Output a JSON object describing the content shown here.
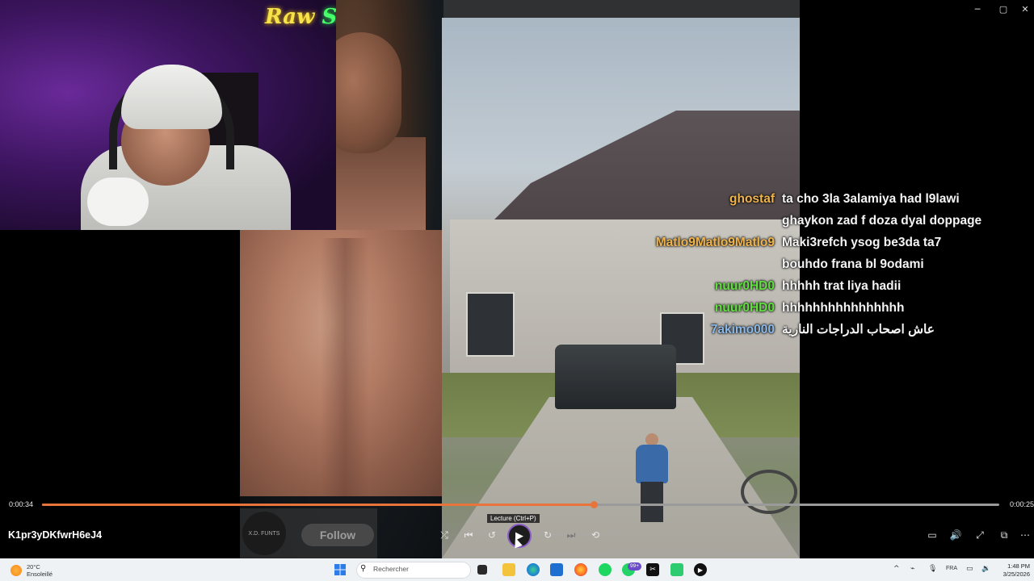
{
  "window": {
    "minimize_glyph": "─",
    "maximize_glyph": "▢",
    "close_glyph": "✕"
  },
  "webcam": {
    "neon_sign_part1": "Raw ",
    "neon_sign_part2": "Sauce"
  },
  "chat": {
    "messages": [
      {
        "user": "ghostaf",
        "user_color": "#f0b44c",
        "text": "ta cho 3la 3alamiya had l9lawi"
      },
      {
        "user": "",
        "user_color": "#f0b44c",
        "text": "ghaykon zad f doza dyal doppage"
      },
      {
        "user": "Matlo9Matlo9Matlo9",
        "user_color": "#f0b44c",
        "text": "Maki3refch ysog be3da ta7"
      },
      {
        "user": "",
        "user_color": "#f0b44c",
        "text": "bouhdo frana bl 9odami"
      },
      {
        "user": "nuur0HD0",
        "user_color": "#5fe03f",
        "text": "hhhhh trat liya hadii"
      },
      {
        "user": "nuur0HD0",
        "user_color": "#5fe03f",
        "text": "hhhhhhhhhhhhhhhh"
      },
      {
        "user": "7akimo000",
        "user_color": "#8ab8e8",
        "text": "عاش اصحاب الدراجات النارية"
      }
    ]
  },
  "follow": {
    "label": "Follow",
    "avatar_text": "X.D. FUNTS"
  },
  "player": {
    "title": "K1pr3yDKfwrH6eJ4",
    "time_elapsed": "0:00:34",
    "time_remaining": "0:00:25",
    "progress": 0.576,
    "accent_color": "#e8743b",
    "tooltip": "Lecture (Ctrl+P)",
    "controls": {
      "shuffle": "⤮",
      "previous": "⏮",
      "rewind": "↺",
      "play": "▶",
      "forward": "↻",
      "next": "⏭",
      "repeat": "⟲",
      "miniplayer": "▭",
      "volume": "🔊",
      "fullscreen": "⤢",
      "cast": "⧉",
      "more": "⋯"
    }
  },
  "taskbar": {
    "weather_temp": "20°C",
    "weather_desc": "Ensoleillé",
    "search_placeholder": "Rechercher",
    "search_glyph": "⚲",
    "notification_badge": "99+",
    "language": "FRA",
    "time": "1:48 PM",
    "date": "3/25/2026",
    "tray": {
      "chevron": "^",
      "network": "⌁",
      "mic": "🎙",
      "display": "▭",
      "volume": "🔉"
    }
  }
}
